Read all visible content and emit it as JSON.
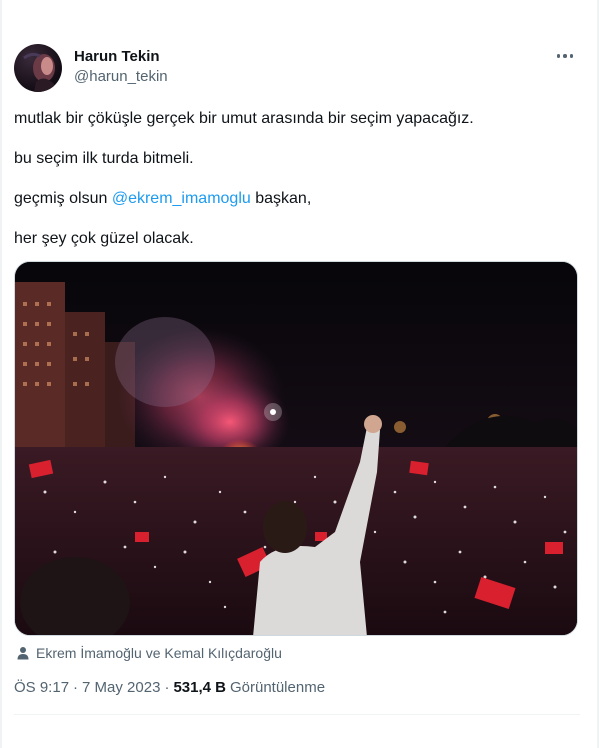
{
  "author": {
    "name": "Harun Tekin",
    "handle": "@harun_tekin"
  },
  "tweet": {
    "line1": "mutlak bir çöküşle gerçek bir umut arasında bir seçim yapacağız.",
    "line2": "bu seçim ilk turda bitmeli.",
    "line3_before": "geçmiş olsun",
    "line3_mention": "@ekrem_imamoglu",
    "line3_after": "başkan,",
    "line4": "her şey çok güzel olacak."
  },
  "media": {
    "tagged_people": "Ekrem İmamoğlu ve Kemal Kılıçdaroğlu"
  },
  "meta": {
    "time": "ÖS 9:17",
    "separator": "·",
    "date": "7 May 2023",
    "views_count": "531,4 B",
    "views_label": "Görüntülenme"
  },
  "colors": {
    "text": "#0f1419",
    "secondary": "#536471",
    "link": "#1d9bf0",
    "border": "#eff3f4"
  },
  "icons": {
    "more": "more-dots-icon",
    "tag": "person-icon"
  }
}
